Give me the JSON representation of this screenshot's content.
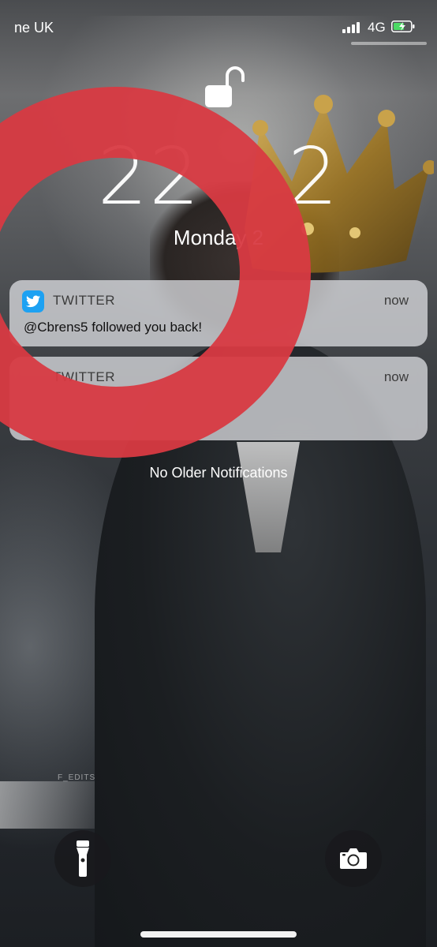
{
  "status_bar": {
    "carrier": "ne UK",
    "network": "4G",
    "signal_bars": 4,
    "battery_state": "charging"
  },
  "lock": {
    "icon": "unlocked-padlock-icon"
  },
  "clock": {
    "time_visible_left": "22",
    "time_visible_right": "2"
  },
  "date": {
    "text": "Monday 2"
  },
  "notifications": [
    {
      "app": "TWITTER",
      "time": "now",
      "body": "@Cbrens5 followed you back!",
      "icon": "twitter-bird-icon"
    },
    {
      "app": "TWITTER",
      "time": "now",
      "body": ""
    }
  ],
  "no_older": "No Older Notifications",
  "wallpaper": {
    "watermark": "F_EDITS"
  },
  "controls": {
    "flashlight_icon": "flashlight-icon",
    "camera_icon": "camera-icon"
  },
  "colors": {
    "annotation_ring": "#d83a42",
    "twitter_blue": "#1da1f2",
    "battery_green": "#4cd964"
  }
}
